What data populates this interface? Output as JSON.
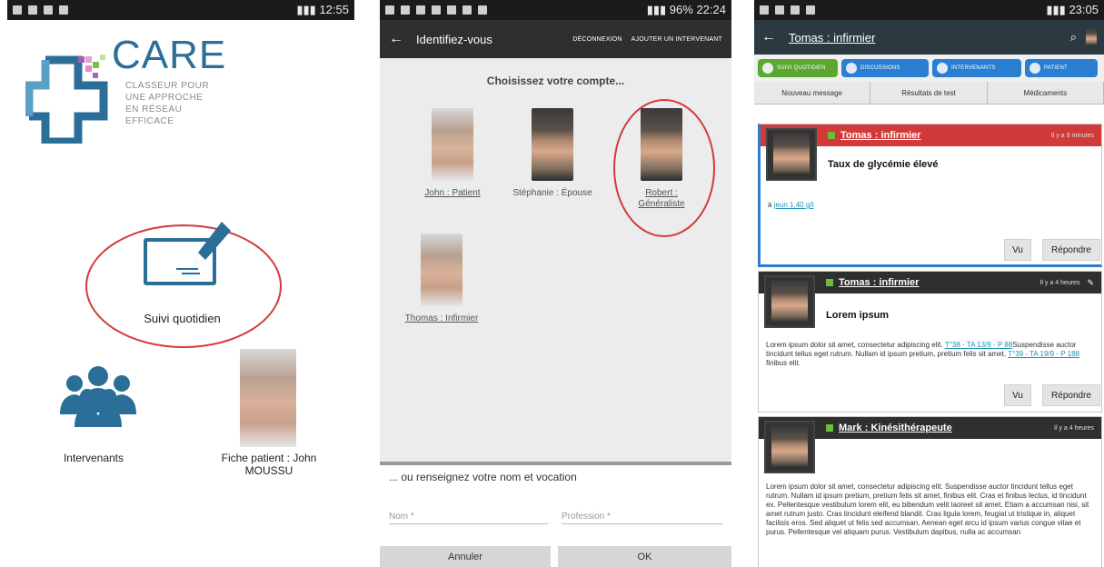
{
  "screens": {
    "home": {
      "status_time": "12:55",
      "logo": {
        "title": "CARE",
        "subtitle": [
          "Classeur pour",
          "une Approche",
          "en Réseau Efficace"
        ]
      },
      "tiles": [
        {
          "label": "Suivi quotidien",
          "icon": "edit-icon"
        },
        {
          "label": "Intervenants",
          "icon": "people-icon"
        },
        {
          "label": "Fiche patient : John MOUSSU",
          "icon": "patient-photo"
        }
      ],
      "colors": {
        "brand": "#2b6e98",
        "highlight": "#d23a3a"
      }
    },
    "login": {
      "status_time": "22:24",
      "status_battery": "96%",
      "title": "Identifiez-vous",
      "actions": [
        "DÉCONNEXION",
        "AJOUTER UN INTERVENANT"
      ],
      "choose_label": "Choisissez votre compte...",
      "accounts": [
        {
          "label": "John : Patient"
        },
        {
          "label": "Stéphanie : Épouse"
        },
        {
          "label": "Robert : Généraliste"
        },
        {
          "label": "Thomas : Infirmier"
        }
      ],
      "manual_label": "... ou renseignez votre nom et vocation",
      "name_placeholder": "Nom *",
      "profession_placeholder": "Profession *",
      "cancel_label": "Annuler",
      "ok_label": "OK"
    },
    "feed": {
      "status_time": "23:05",
      "title": "Tomas : infirmier",
      "tabs": [
        {
          "label": "SUIVI QUOTIDIEN",
          "color": "#5aa832"
        },
        {
          "label": "DISCUSSIONS",
          "color": "#2b7fd1"
        },
        {
          "label": "INTERVENANTS",
          "color": "#2b7fd1"
        },
        {
          "label": "PATIENT",
          "color": "#2b7fd1"
        }
      ],
      "subtabs": [
        "Nouveau message",
        "Résultats de test",
        "Médicaments"
      ],
      "messages": [
        {
          "author": "Tomas : infirmier",
          "time": "Il y a 9 minutes",
          "title": "Taux de glycémie élevé",
          "prefix": "à ",
          "link": "jeun 1,40 g/l",
          "seen_label": "Vu",
          "reply_label": "Répondre",
          "header_color": "#d23a3a"
        },
        {
          "author": "Tomas : infirmier",
          "time": "Il y a 4 heures",
          "title": "Lorem ipsum",
          "text_a": "Lorem ipsum dolor sit amet, consectetur adipiscing elit. ",
          "link_a": "T°38 - TA 13/9 - P 88",
          "text_b": "Suspendisse auctor tincidunt tellus eget rutrum. Nullam id ipsum pretium, pretium felis sit amet, ",
          "link_b": "T°39 - TA 19/9 - P 188",
          "text_c": " finibus elit.",
          "seen_label": "Vu",
          "reply_label": "Répondre",
          "header_color": "#2f2f2f"
        },
        {
          "author": "Mark : Kinésithérapeute",
          "time": "Il y a 4 heures",
          "text": "Lorem ipsum dolor sit amet, consectetur adipiscing elit. Suspendisse auctor tincidunt tellus eget rutrum. Nullam id ipsum pretium, pretium felis sit amet, finibus elit. Cras et finibus lectus, id tincidunt ex. Pellentesque vestibulum lorem elit, eu bibendum velit laoreet sit amet. Etiam a accumsan nisi, sit amet rutrum justo. Cras tincidunt eleifend blandit. Cras ligula lorem, feugiat ut tristique in, aliquet facilisis eros. Sed aliquet ut felis sed accumsan. Aenean eget arcu id ipsum varius congue vitae et purus. Pellentesque vel aliquam purus. Vestibulum dapibus, nulla ac accumsan",
          "header_color": "#2f2f2f"
        }
      ]
    }
  }
}
